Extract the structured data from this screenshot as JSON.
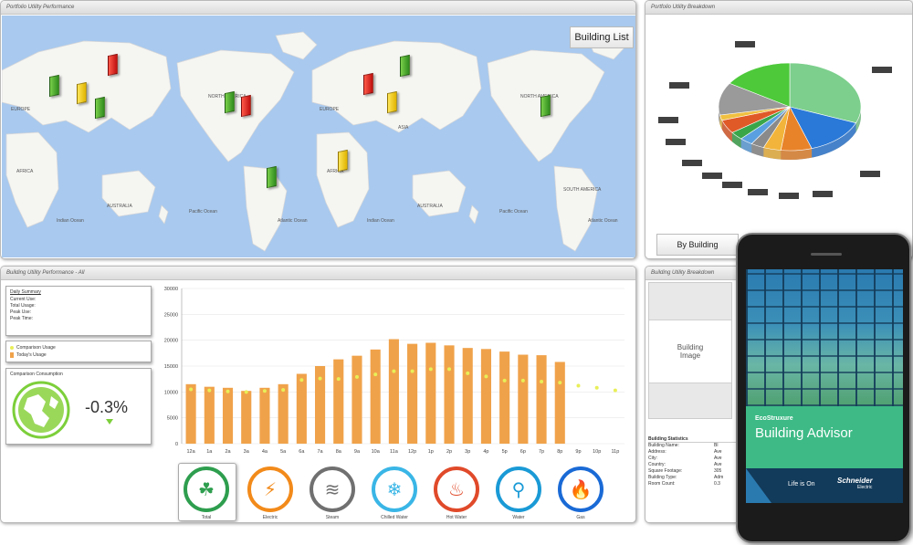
{
  "colors": {
    "ocean": "#a9c9ee",
    "land": "#f5f5f2",
    "bar": "#f0a24a",
    "comparison_dot": "#e8ef58",
    "pie_light_green": "#7ccf8c",
    "pie_blue": "#2a79d8",
    "pie_green": "#4dc93a"
  },
  "map_panel": {
    "title": "Portfolio Utility Performance",
    "building_list_button": "Building List",
    "labels": [
      {
        "text": "EUROPE"
      },
      {
        "text": "AFRICA"
      },
      {
        "text": "AUSTRALIA"
      },
      {
        "text": "Indian Ocean"
      },
      {
        "text": "NORTH AMERICA"
      },
      {
        "text": "Pacific Ocean"
      },
      {
        "text": "EUROPE"
      },
      {
        "text": "ASIA"
      },
      {
        "text": "AFRICA"
      },
      {
        "text": "Atlantic Ocean"
      },
      {
        "text": "AUSTRALIA"
      },
      {
        "text": "Indian Ocean"
      },
      {
        "text": "NORTH AMERICA"
      },
      {
        "text": "Pacific Ocean"
      },
      {
        "text": "SOUTH AMERICA"
      },
      {
        "text": "Atlantic Ocean"
      }
    ],
    "markers": [
      {
        "color": "green"
      },
      {
        "color": "yellow"
      },
      {
        "color": "red"
      },
      {
        "color": "green"
      },
      {
        "color": "green"
      },
      {
        "color": "red"
      },
      {
        "color": "green"
      },
      {
        "color": "red"
      },
      {
        "color": "green"
      },
      {
        "color": "yellow"
      },
      {
        "color": "yellow"
      },
      {
        "color": "green"
      }
    ]
  },
  "breakdown_panel": {
    "title": "Portfolio Utility Breakdown",
    "by_building_button": "By Building"
  },
  "pie_data": {
    "type": "pie",
    "slices": [
      {
        "color": "#7ccf8c",
        "value": 31
      },
      {
        "color": "#2a79d8",
        "value": 14
      },
      {
        "color": "#e8832a",
        "value": 7
      },
      {
        "color": "#f2b43a",
        "value": 4
      },
      {
        "color": "#8a8a8a",
        "value": 3
      },
      {
        "color": "#5aa0e0",
        "value": 3
      },
      {
        "color": "#3aa64a",
        "value": 3
      },
      {
        "color": "#e05a28",
        "value": 5
      },
      {
        "color": "#f0c040",
        "value": 2
      },
      {
        "color": "#9a9a9a",
        "value": 12
      },
      {
        "color": "#4dc93a",
        "value": 16
      }
    ]
  },
  "performance_panel": {
    "title": "Building Utility Performance - All",
    "daily_summary": {
      "title": "Daily Summary",
      "rows": [
        "Current Use:",
        "Total Usage:",
        "Peak Use:",
        "Peak Time:"
      ]
    },
    "legend": {
      "comparison": "Comparison Usage",
      "today": "Today's Usage"
    },
    "comparison_box": {
      "title": "Comparison Consumption",
      "value": "-0.3%"
    },
    "utilities": [
      {
        "label": "Total",
        "icon": "leaf-icon",
        "glyph": "☘",
        "color": "#2e9e4e"
      },
      {
        "label": "Electric",
        "icon": "lightning-icon",
        "glyph": "⚡",
        "color": "#f28a1a"
      },
      {
        "label": "Steam",
        "icon": "steam-icon",
        "glyph": "≋",
        "color": "#707070"
      },
      {
        "label": "Chilled Water",
        "icon": "snowflake-icon",
        "glyph": "❄",
        "color": "#3ab6e6"
      },
      {
        "label": "Hot Water",
        "icon": "hot-water-icon",
        "glyph": "♨",
        "color": "#e04a2a"
      },
      {
        "label": "Water",
        "icon": "faucet-icon",
        "glyph": "⚲",
        "color": "#1a9ad6"
      },
      {
        "label": "Gas",
        "icon": "flame-icon",
        "glyph": "🔥",
        "color": "#1a6ad6"
      }
    ]
  },
  "chart_data": {
    "type": "bar",
    "categories": [
      "12a",
      "1a",
      "2a",
      "3a",
      "4a",
      "5a",
      "6a",
      "7a",
      "8a",
      "9a",
      "10a",
      "11a",
      "12p",
      "1p",
      "2p",
      "3p",
      "4p",
      "5p",
      "6p",
      "7p",
      "8p",
      "9p",
      "10p",
      "11p"
    ],
    "series": [
      {
        "name": "Today's Usage",
        "values": [
          11500,
          11000,
          10800,
          10200,
          10800,
          11500,
          13500,
          15000,
          16300,
          17000,
          18200,
          20200,
          19300,
          19500,
          19000,
          18500,
          18300,
          17800,
          17200,
          17100,
          15800,
          null,
          null,
          null
        ]
      },
      {
        "name": "Comparison Usage",
        "values": [
          10500,
          10300,
          10100,
          10000,
          10200,
          10400,
          12300,
          12600,
          12500,
          12900,
          13400,
          14000,
          14000,
          14400,
          14400,
          13600,
          13000,
          12200,
          12200,
          12000,
          11800,
          11200,
          10800,
          10300
        ]
      }
    ],
    "yticks": [
      "0",
      "5000",
      "10000",
      "15000",
      "20000",
      "25000",
      "30000"
    ],
    "ylim": [
      0,
      30000
    ]
  },
  "info_panel": {
    "title": "Building Utility Breakdown",
    "image_placeholder": "Building Image",
    "stats_title": "Building Statistics",
    "stats": [
      "Building Name:",
      "Address:",
      "City:",
      "Country:",
      "Square Footage:",
      "Building Type:",
      "Room Count:"
    ],
    "stat_values": [
      "Bl",
      "Ave",
      "Ave",
      "Ave",
      "305",
      "Adm",
      "0.3"
    ]
  },
  "phone": {
    "brand": "EcoStruxure",
    "app_name": "Building Advisor",
    "tagline": "Life is On",
    "company": "Schneider",
    "company_sub": "Electric"
  }
}
